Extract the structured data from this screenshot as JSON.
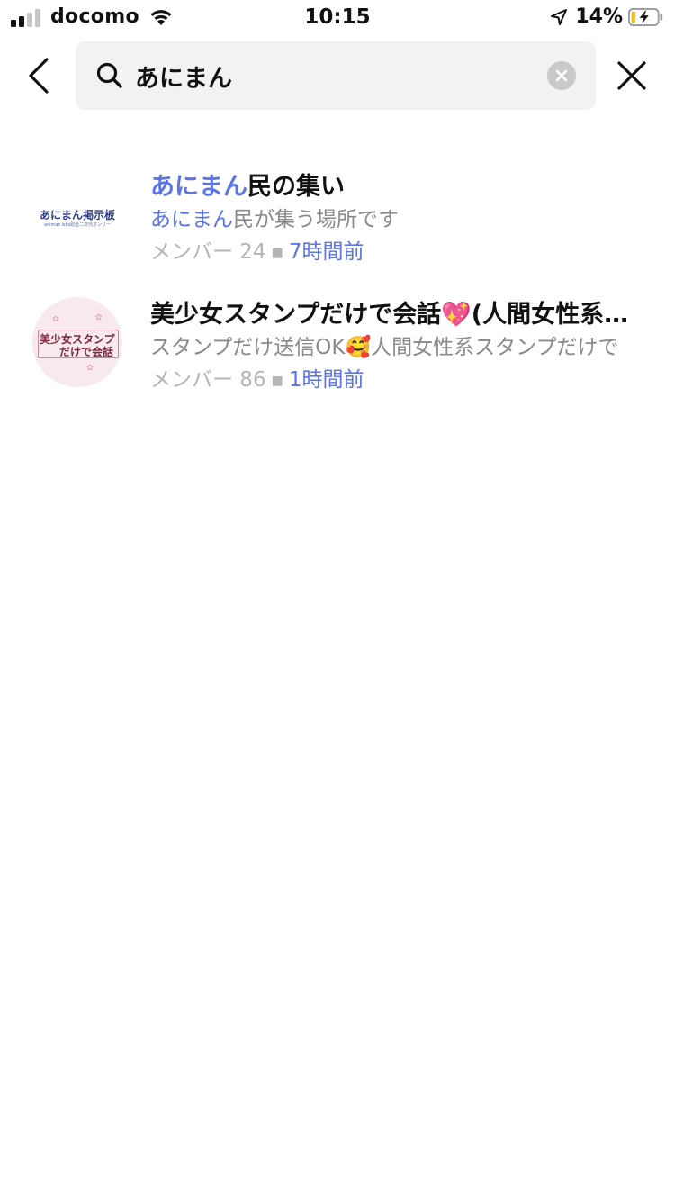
{
  "status_bar": {
    "carrier": "docomo",
    "time": "10:15",
    "battery_percent": "14%",
    "icons": [
      "signal-icon",
      "wifi-icon",
      "location-arrow-icon",
      "battery-charging-icon"
    ]
  },
  "search": {
    "query": "あにまん",
    "icons": [
      "back-chevron-icon",
      "search-icon",
      "clear-icon",
      "close-icon"
    ]
  },
  "results": [
    {
      "thumb_text": "あにまん掲示板",
      "thumb_sub": "animan bbs総合二次元オンリー",
      "title_highlight": "あにまん",
      "title_rest": "民の集い",
      "desc_highlight": "あにまん",
      "desc_rest": "民が集う場所です",
      "members": "メンバー 24",
      "time": "7時間前"
    },
    {
      "thumb_line1": "美少女スタンプ",
      "thumb_line2": "だけで会話",
      "title_highlight": "",
      "title_rest": "美少女スタンプだけで会話💖(人間女性系スタンプ",
      "desc_highlight": "",
      "desc_rest": "スタンプだけ送信OK🥰人間女性系スタンプだけで",
      "members": "メンバー 86",
      "time": "1時間前"
    }
  ],
  "colors": {
    "accent": "#5b74e8",
    "muted": "#8a8a8a",
    "search_bg": "#f2f2f3"
  }
}
